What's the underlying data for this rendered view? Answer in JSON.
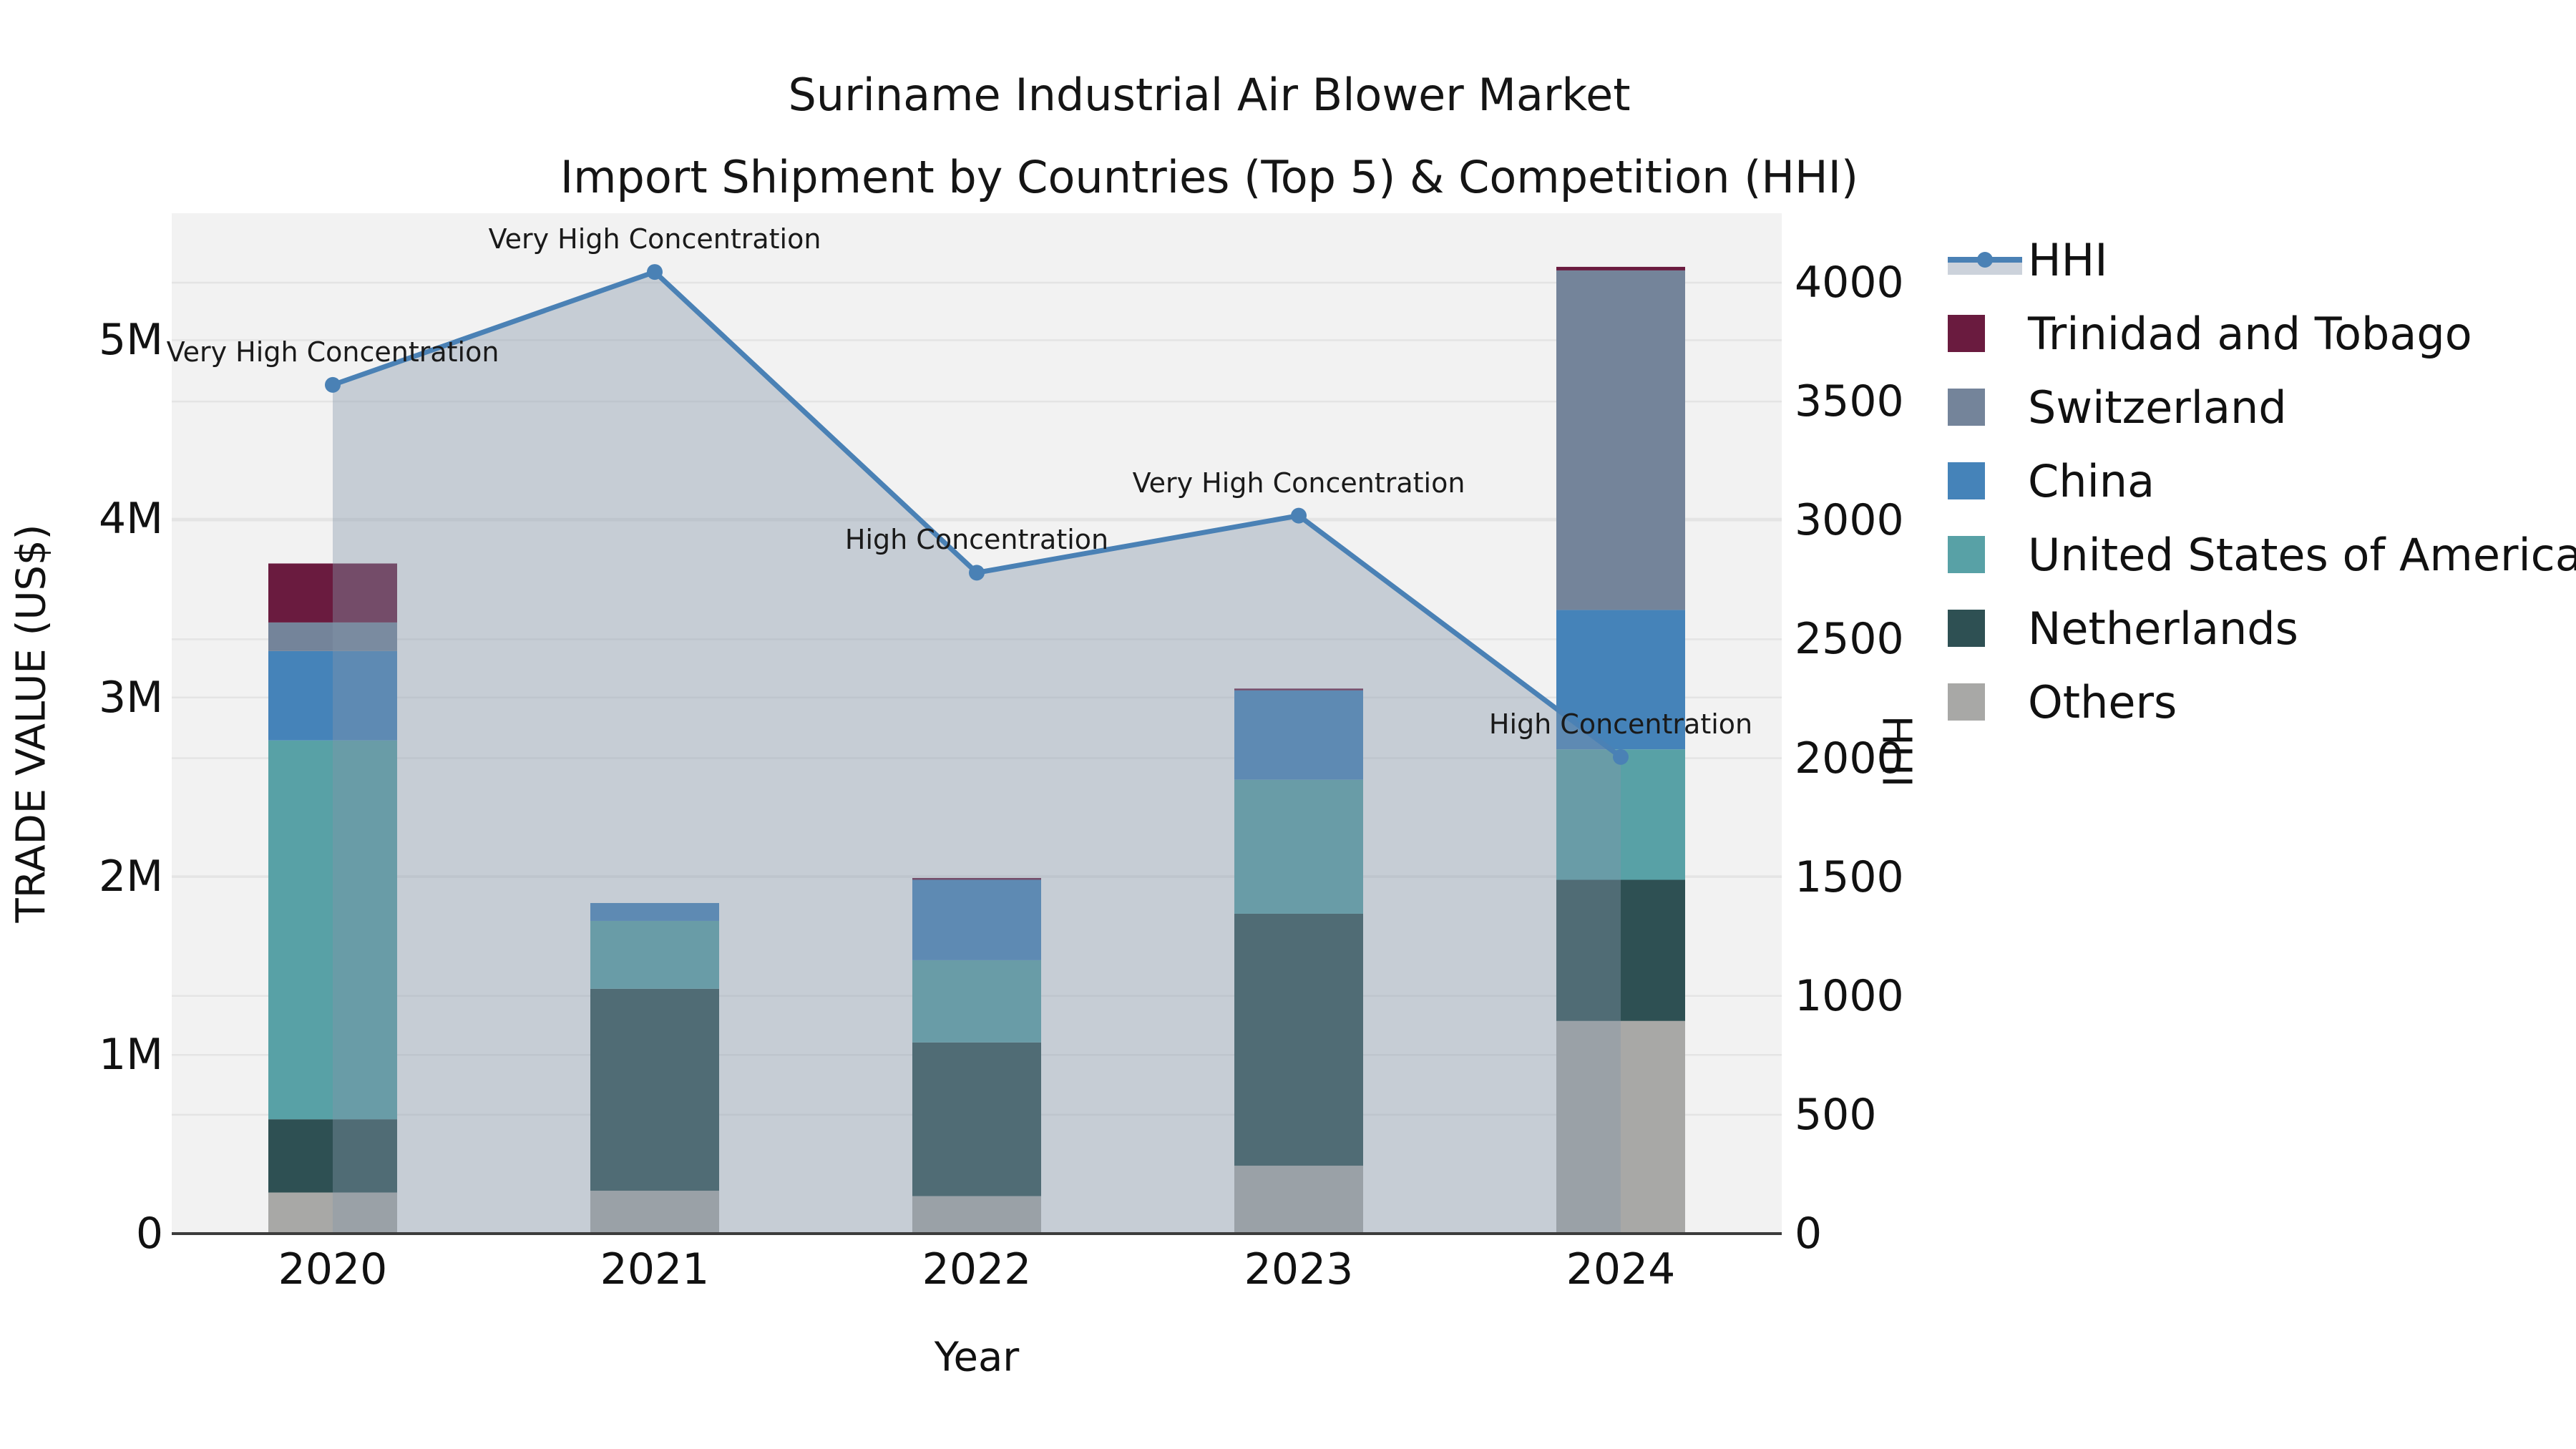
{
  "header": {
    "title_line1": "Suriname Industrial Air Blower Market",
    "title_line2": "Import Shipment by Countries (Top 5) & Competition (HHI)"
  },
  "chart_data": {
    "type": "bar",
    "subtype": "stacked-bars-with-line-overlay",
    "title": "Suriname Industrial Air Blower Market — Import Shipment by Countries (Top 5) & Competition (HHI)",
    "xlabel": "Year",
    "ylabel_left": "TRADE VALUE (US$)",
    "ylabel_right": "HHI",
    "categories": [
      "2020",
      "2021",
      "2022",
      "2023",
      "2024"
    ],
    "values_unit": "million US$",
    "series": [
      {
        "name": "Trinidad and Tobago",
        "color": "#6A1B3F",
        "values": [
          0.33,
          0,
          0.01,
          0.01,
          0.02
        ]
      },
      {
        "name": "Switzerland",
        "color": "#74849A",
        "values": [
          0.16,
          0,
          0,
          0,
          1.9
        ]
      },
      {
        "name": "China",
        "color": "#4583B9",
        "values": [
          0.5,
          0.1,
          0.45,
          0.5,
          0.78
        ]
      },
      {
        "name": "United States of America",
        "color": "#58A1A6",
        "values": [
          2.12,
          0.38,
          0.46,
          0.75,
          0.73
        ]
      },
      {
        "name": "Netherlands",
        "color": "#2E5053",
        "values": [
          0.41,
          1.13,
          0.86,
          1.41,
          0.79
        ]
      },
      {
        "name": "Others",
        "color": "#A8A8A6",
        "values": [
          0.23,
          0.24,
          0.21,
          0.38,
          1.19
        ]
      }
    ],
    "stack_order_bottom_to_top": [
      "Others",
      "Netherlands",
      "United States of America",
      "China",
      "Switzerland",
      "Trinidad and Tobago"
    ],
    "bar_totals_M": [
      3.75,
      1.85,
      1.99,
      3.05,
      5.41
    ],
    "line": {
      "name": "HHI",
      "color": "#4A81B5",
      "area_fill": "rgba(132,149,171,0.40)",
      "values": [
        3570,
        4045,
        2780,
        3020,
        2005
      ]
    },
    "annotations": [
      "Very High Concentration",
      "Very High Concentration",
      "High Concentration",
      "Very High Concentration",
      "High Concentration"
    ],
    "axes": {
      "left": {
        "ticks": [
          "0",
          "1M",
          "2M",
          "3M",
          "4M",
          "5M"
        ],
        "tick_values": [
          0,
          1,
          2,
          3,
          4,
          5
        ],
        "ylim": [
          0,
          5.71
        ]
      },
      "right": {
        "ticks": [
          "0",
          "500",
          "1000",
          "1500",
          "2000",
          "2500",
          "3000",
          "3500",
          "4000"
        ],
        "tick_values": [
          0,
          500,
          1000,
          1500,
          2000,
          2500,
          3000,
          3500,
          4000
        ],
        "ylim": [
          0,
          4292
        ]
      }
    },
    "grid": true,
    "plot_bg": "#f2f2f2",
    "gridline_color": "#e4e4e4",
    "spine_color": "#3c3c3c",
    "legend_position": "right"
  },
  "legend": {
    "items": [
      {
        "label": "HHI",
        "color": "#4A81B5",
        "band": "#ccd2db"
      },
      {
        "label": "Trinidad and Tobago",
        "color": "#6A1B3F"
      },
      {
        "label": "Switzerland",
        "color": "#74849A"
      },
      {
        "label": "China",
        "color": "#4583B9"
      },
      {
        "label": "United States of America",
        "color": "#58A1A6"
      },
      {
        "label": "Netherlands",
        "color": "#2E5053"
      },
      {
        "label": "Others",
        "color": "#A8A8A6"
      }
    ]
  }
}
